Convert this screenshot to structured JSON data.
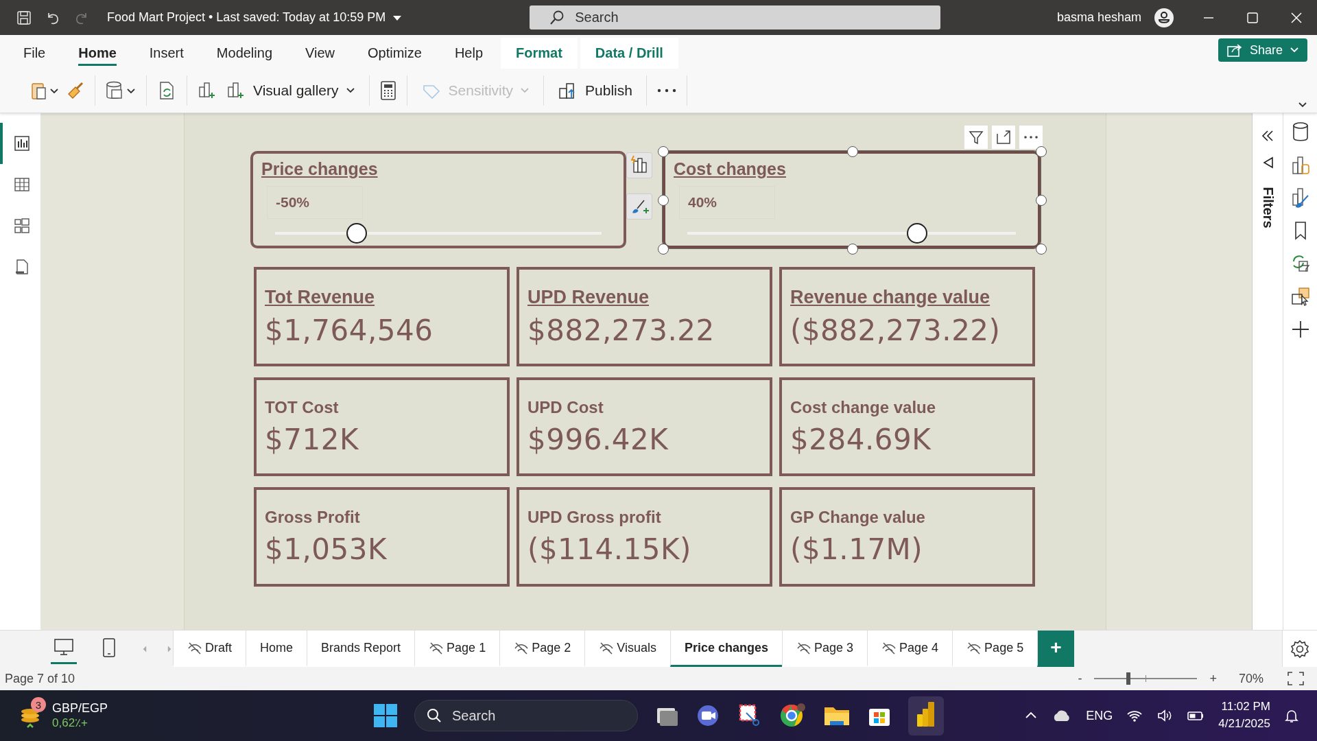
{
  "titlebar": {
    "title": "Food Mart Project • Last saved: Today at 10:59 PM",
    "search_placeholder": "Search",
    "user": "basma hesham"
  },
  "ribbon_tabs": [
    {
      "label": "File",
      "kind": "standard",
      "selected": false
    },
    {
      "label": "Home",
      "kind": "standard",
      "selected": true
    },
    {
      "label": "Insert",
      "kind": "standard",
      "selected": false
    },
    {
      "label": "Modeling",
      "kind": "standard",
      "selected": false
    },
    {
      "label": "View",
      "kind": "standard",
      "selected": false
    },
    {
      "label": "Optimize",
      "kind": "standard",
      "selected": false
    },
    {
      "label": "Help",
      "kind": "standard",
      "selected": false
    },
    {
      "label": "Format",
      "kind": "contextual",
      "selected": false
    },
    {
      "label": "Data / Drill",
      "kind": "contextual",
      "selected": false
    }
  ],
  "share_button": "Share",
  "toolbar": {
    "visual_gallery": "Visual gallery",
    "sensitivity": {
      "label": "Sensitivity",
      "disabled": true
    },
    "publish": "Publish"
  },
  "view_nav": [
    {
      "selected": true
    },
    {
      "selected": false
    },
    {
      "selected": false
    },
    {
      "selected": false
    }
  ],
  "filters_pane": {
    "label": "Filters"
  },
  "slicers": [
    {
      "title": "Price changes",
      "value": "-50%",
      "level": 0.25,
      "selected": false
    },
    {
      "title": "Cost changes",
      "value": "40%",
      "level": 0.7,
      "selected": true
    }
  ],
  "cards": [
    {
      "title": "Tot Revenue",
      "value": "$1,764,546",
      "kind": "headline"
    },
    {
      "title": "UPD Revenue",
      "value": "$882,273.22",
      "kind": "headline"
    },
    {
      "title": "Revenue change value",
      "value": "($882,273.22)",
      "kind": "headline"
    },
    {
      "title": "TOT Cost",
      "value": "$712K",
      "kind": "plain"
    },
    {
      "title": "UPD Cost",
      "value": "$996.42K",
      "kind": "plain"
    },
    {
      "title": "Cost change value",
      "value": "$284.69K",
      "kind": "plain"
    },
    {
      "title": "Gross Profit",
      "value": "$1,053K",
      "kind": "plain"
    },
    {
      "title": "UPD Gross profit",
      "value": "($114.15K)",
      "kind": "plain"
    },
    {
      "title": "GP Change value",
      "value": "($1.17M)",
      "kind": "plain"
    }
  ],
  "layout_views": [
    {
      "selected": true
    },
    {
      "selected": false
    }
  ],
  "page_tabs": [
    {
      "label": "Draft",
      "hidden": true,
      "selected": false
    },
    {
      "label": "Home",
      "hidden": false,
      "selected": false
    },
    {
      "label": "Brands Report",
      "hidden": false,
      "selected": false
    },
    {
      "label": "Page 1",
      "hidden": true,
      "selected": false
    },
    {
      "label": "Page 2",
      "hidden": true,
      "selected": false
    },
    {
      "label": "Visuals",
      "hidden": true,
      "selected": false
    },
    {
      "label": "Price changes",
      "hidden": false,
      "selected": true
    },
    {
      "label": "Page 3",
      "hidden": true,
      "selected": false
    },
    {
      "label": "Page 4",
      "hidden": true,
      "selected": false
    },
    {
      "label": "Page 5",
      "hidden": true,
      "selected": false
    }
  ],
  "add_page_button": "+",
  "status_bar": {
    "page": "Page 7 of 10",
    "zoom_out": "-",
    "zoom_in": "+",
    "zoom": "70%",
    "zoom_slider": {
      "level": 0.33
    }
  },
  "taskbar": {
    "widget": {
      "badge": "3",
      "title": "GBP/EGP",
      "value": "0,62٪+"
    },
    "search_placeholder": "Search",
    "language": "ENG",
    "time": "11:02 PM",
    "date": "4/21/2025"
  }
}
